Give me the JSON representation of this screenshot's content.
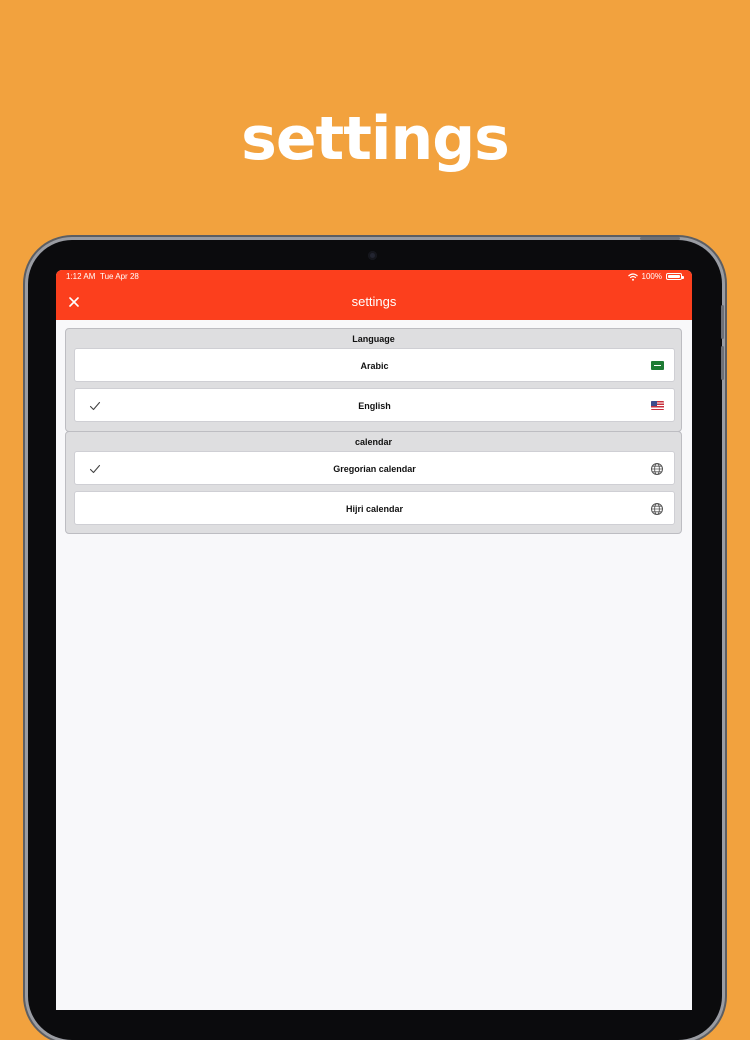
{
  "hero": {
    "title": "settings"
  },
  "status_bar": {
    "time": "1:12 AM",
    "date": "Tue Apr 28",
    "battery": "100%"
  },
  "nav": {
    "title": "settings",
    "close_icon": "close-icon"
  },
  "sections": [
    {
      "header": "Language",
      "rows": [
        {
          "label": "Arabic",
          "checked": false,
          "trailing_icon": "saudi-flag-icon"
        },
        {
          "label": "English",
          "checked": true,
          "trailing_icon": "us-flag-icon"
        }
      ]
    },
    {
      "header": "calendar",
      "rows": [
        {
          "label": "Gregorian calendar",
          "checked": true,
          "trailing_icon": "globe-icon"
        },
        {
          "label": "Hijri calendar",
          "checked": false,
          "trailing_icon": "globe-icon"
        }
      ]
    }
  ],
  "colors": {
    "background": "#F2A23E",
    "accent": "#FC3F1D",
    "screen": "#F8F8FA",
    "section": "#DEDEE0"
  }
}
